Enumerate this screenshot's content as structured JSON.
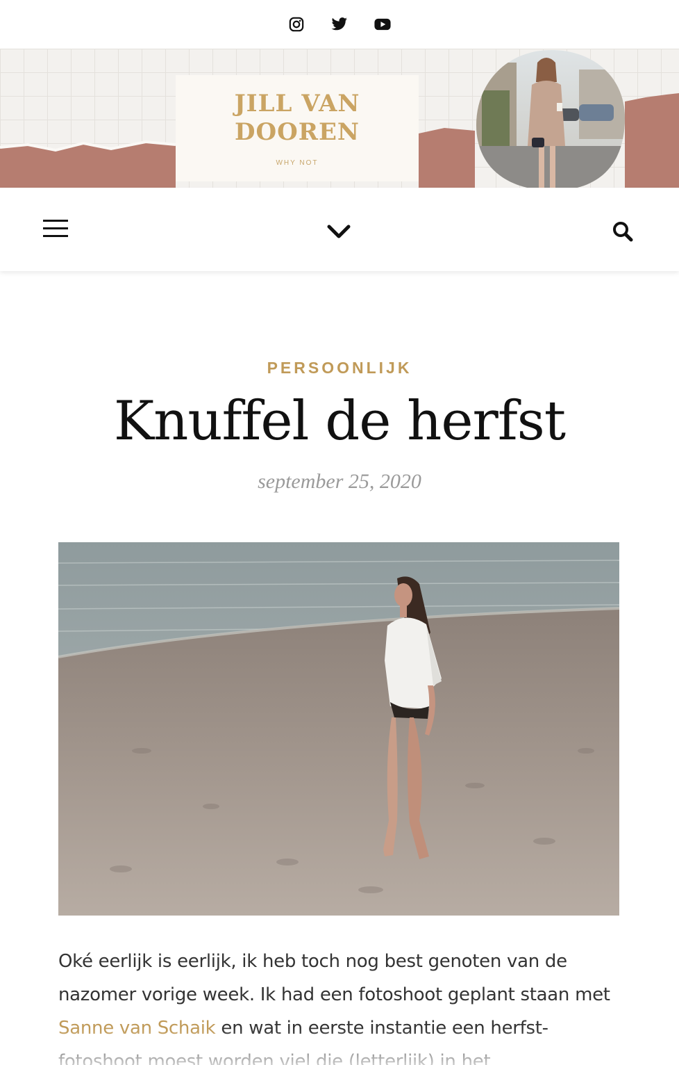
{
  "social": {
    "icons": [
      "instagram-icon",
      "twitter-icon",
      "youtube-icon"
    ]
  },
  "header": {
    "logo_line1": "JILL VAN",
    "logo_line2": "DOOREN",
    "tagline": "WHY NOT",
    "colors": {
      "accent": "#c09a58",
      "banner_clay": "#b67d70",
      "logo_gold": "#caa463"
    }
  },
  "nav": {
    "menu_icon": "hamburger-icon",
    "center_icon": "chevron-down-icon",
    "search_icon": "search-icon"
  },
  "post": {
    "category": "PERSOONLIJK",
    "title": "Knuffel de herfst",
    "date": "september 25, 2020",
    "body_start": "Oké eerlijk is eerlijk, ik heb toch nog best genoten van de nazomer vorige week. Ik had een fotoshoot geplant staan met ",
    "body_link": "Sanne van Schaik",
    "body_end": " en wat in eerste instantie een herfst-fotoshoot moest worden viel die (letterlijk) in het"
  }
}
